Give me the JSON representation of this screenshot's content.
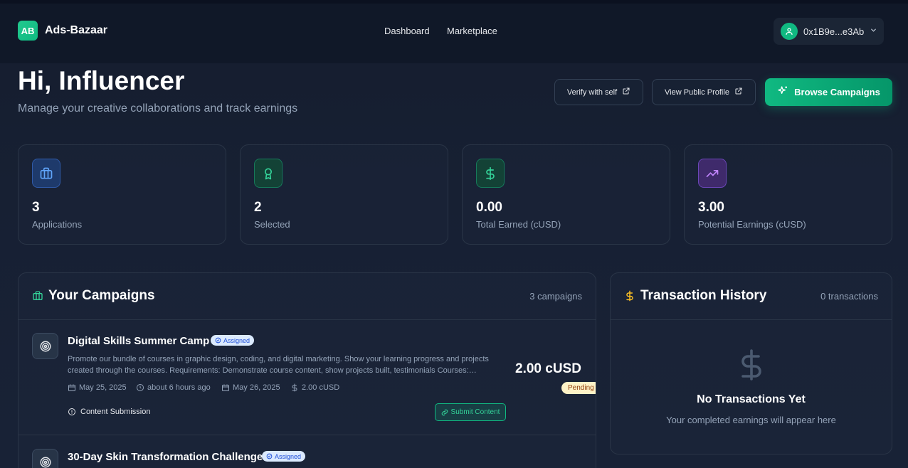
{
  "header": {
    "logo": "AB",
    "brand": "Ads-Bazaar",
    "nav": [
      "Dashboard",
      "Marketplace"
    ],
    "wallet": "0x1B9e...e3Ab"
  },
  "greeting": {
    "title": "Hi, Influencer",
    "subtitle": "Manage your creative collaborations and track earnings"
  },
  "actions": {
    "verify": "Verify with self",
    "profile": "View Public Profile",
    "browse": "Browse Campaigns"
  },
  "stats": [
    {
      "value": "3",
      "label": "Applications",
      "icon": "briefcase-icon",
      "color": "#3b82f6"
    },
    {
      "value": "2",
      "label": "Selected",
      "icon": "award-icon",
      "color": "#10b981"
    },
    {
      "value": "0.00",
      "label": "Total Earned (cUSD)",
      "icon": "dollar-icon",
      "color": "#10b981"
    },
    {
      "value": "3.00",
      "label": "Potential Earnings (cUSD)",
      "icon": "trending-up-icon",
      "color": "#a855f7"
    }
  ],
  "campaigns": {
    "title": "Your Campaigns",
    "count": "3 campaigns",
    "items": [
      {
        "title": "Digital Skills Summer Camp",
        "status": "Assigned",
        "description": "Promote our bundle of courses in graphic design, coding, and digital marketing. Show your learning progress and projects created through the courses. Requirements: Demonstrate course content, show projects built, testimonials Courses:…",
        "start": "May 25, 2025",
        "ago": "about 6 hours ago",
        "end": "May 26, 2025",
        "budget": "2.00 cUSD",
        "amount": "2.00 cUSD",
        "payment_status": "Pending",
        "submission_label": "Content Submission",
        "submit_label": "Submit Content"
      },
      {
        "title": "30-Day Skin Transformation Challenge",
        "status": "Assigned"
      }
    ]
  },
  "transactions": {
    "title": "Transaction History",
    "count": "0 transactions",
    "empty_title": "No Transactions Yet",
    "empty_sub": "Your completed earnings will appear here"
  }
}
